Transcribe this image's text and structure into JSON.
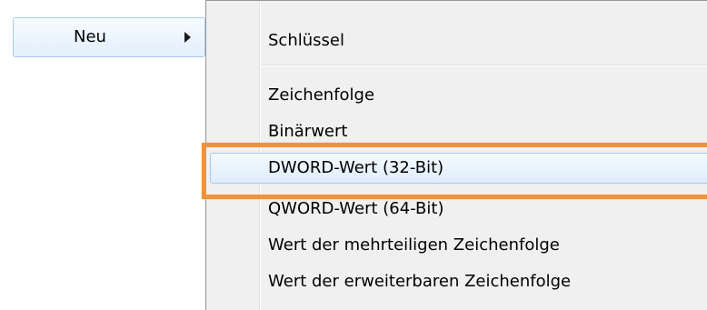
{
  "parent_menu": {
    "item_label": "Neu"
  },
  "submenu": {
    "items": [
      {
        "label": "Schlüssel"
      },
      {
        "label": "Zeichenfolge"
      },
      {
        "label": "Binärwert"
      },
      {
        "label": "DWORD-Wert (32-Bit)",
        "highlighted": true
      },
      {
        "label": "QWORD-Wert (64-Bit)"
      },
      {
        "label": "Wert der mehrteiligen Zeichenfolge"
      },
      {
        "label": "Wert der erweiterbaren Zeichenfolge"
      }
    ]
  },
  "colors": {
    "callout_border": "#f0923b",
    "hover_border": "#a8c8ec",
    "menu_background": "#f0f0f0"
  }
}
